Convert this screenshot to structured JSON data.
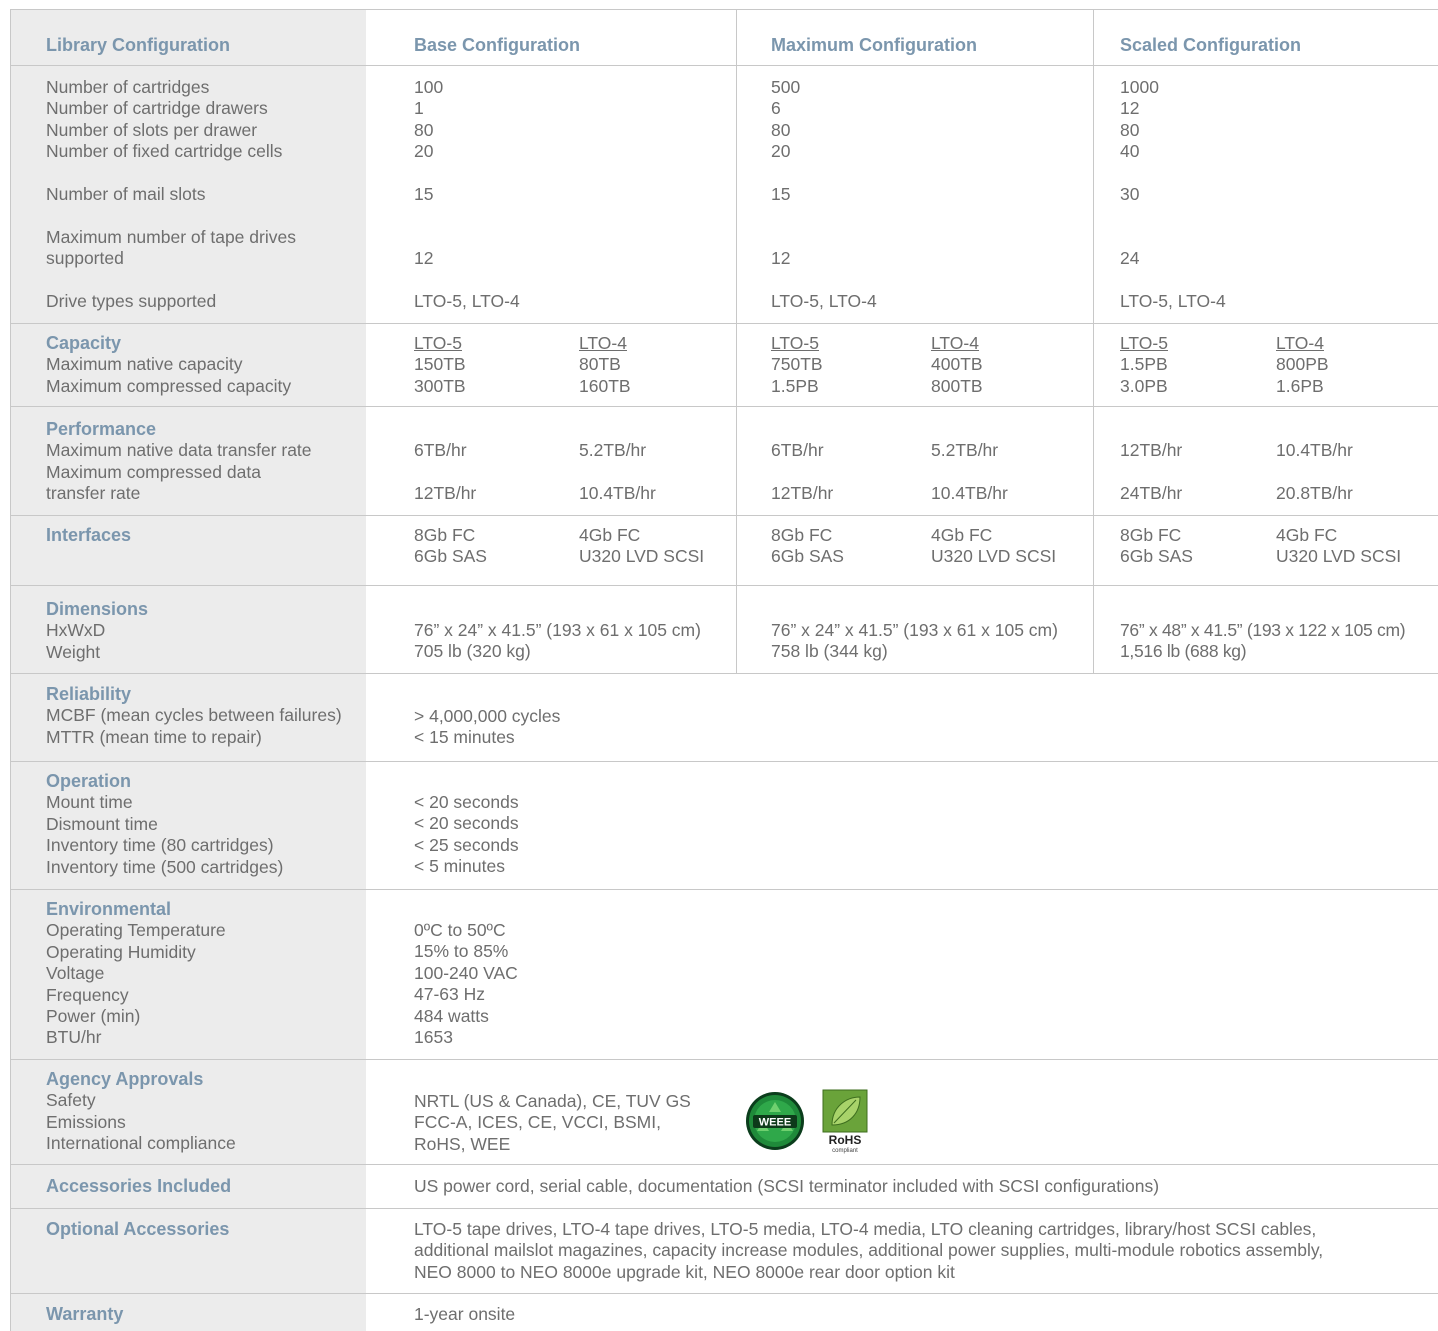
{
  "header": {
    "library_configuration": "Library Configuration",
    "base": "Base Configuration",
    "maximum": "Maximum Configuration",
    "scaled": "Scaled Configuration"
  },
  "config": {
    "labels": [
      "Number of cartridges",
      "Number of cartridge drawers",
      "Number of slots per drawer",
      "Number of fixed cartridge cells"
    ],
    "base": [
      "100",
      "1",
      "80",
      "20"
    ],
    "maximum": [
      "500",
      "6",
      "80",
      "20"
    ],
    "scaled": [
      "1000",
      "12",
      "80",
      "40"
    ],
    "mail_label": "Number of mail slots",
    "mail": {
      "base": "15",
      "maximum": "15",
      "scaled": "30"
    },
    "drives_label_1": "Maximum number of tape drives",
    "drives_label_2": "supported",
    "drives": {
      "base": "12",
      "maximum": "12",
      "scaled": "24"
    },
    "types_label": "Drive types supported",
    "types": {
      "base": "LTO-5, LTO-4",
      "maximum": "LTO-5, LTO-4",
      "scaled": "LTO-5, LTO-4"
    }
  },
  "capacity": {
    "title": "Capacity",
    "labels": [
      "Maximum native capacity",
      "Maximum compressed capacity"
    ],
    "lto5": "LTO-5",
    "lto4": "LTO-4",
    "base": {
      "lto5": [
        "150TB",
        "300TB"
      ],
      "lto4": [
        "80TB",
        "160TB"
      ]
    },
    "maximum": {
      "lto5": [
        "750TB",
        "1.5PB"
      ],
      "lto4": [
        "400TB",
        "800TB"
      ]
    },
    "scaled": {
      "lto5": [
        "1.5PB",
        "3.0PB"
      ],
      "lto4": [
        "800PB",
        "1.6PB"
      ]
    }
  },
  "performance": {
    "title": "Performance",
    "native_label": "Maximum native data transfer rate",
    "compressed_label_1": "Maximum compressed data",
    "compressed_label_2": "transfer rate",
    "base": {
      "lto5": [
        "6TB/hr",
        "12TB/hr"
      ],
      "lto4": [
        "5.2TB/hr",
        "10.4TB/hr"
      ]
    },
    "maximum": {
      "lto5": [
        "6TB/hr",
        "12TB/hr"
      ],
      "lto4": [
        "5.2TB/hr",
        "10.4TB/hr"
      ]
    },
    "scaled": {
      "lto5": [
        "12TB/hr",
        "24TB/hr"
      ],
      "lto4": [
        "10.4TB/hr",
        "20.8TB/hr"
      ]
    }
  },
  "interfaces": {
    "title": "Interfaces",
    "lto5": [
      "8Gb FC",
      "6Gb SAS"
    ],
    "lto4": [
      "4Gb FC",
      "U320 LVD SCSI"
    ]
  },
  "dimensions": {
    "title": "Dimensions",
    "labels": [
      "HxWxD",
      "Weight"
    ],
    "base": [
      "76” x 24” x 41.5” (193 x 61 x 105 cm)",
      "705 lb (320 kg)"
    ],
    "maximum": [
      "76” x 24” x 41.5” (193 x 61 x 105 cm)",
      "758 lb (344 kg)"
    ],
    "scaled": [
      "76” x 48” x 41.5” (193 x 122 x 105 cm)",
      "1,516 lb (688 kg)"
    ]
  },
  "reliability": {
    "title": "Reliability",
    "labels": [
      "MCBF (mean cycles between failures)",
      "MTTR (mean time to repair)"
    ],
    "values": [
      "> 4,000,000 cycles",
      "< 15 minutes"
    ]
  },
  "operation": {
    "title": "Operation",
    "labels": [
      "Mount time",
      "Dismount time",
      "Inventory time (80 cartridges)",
      "Inventory time (500 cartridges)"
    ],
    "values": [
      "< 20 seconds",
      "< 20 seconds",
      "< 25 seconds",
      "< 5 minutes"
    ]
  },
  "environmental": {
    "title": "Environmental",
    "labels": [
      "Operating Temperature",
      "Operating Humidity",
      "Voltage",
      "Frequency",
      "Power (min)",
      "BTU/hr"
    ],
    "values": [
      "0ºC to 50ºC",
      "15% to 85%",
      "100-240 VAC",
      "47-63 Hz",
      "484 watts",
      "1653"
    ]
  },
  "agency": {
    "title": "Agency Approvals",
    "labels": [
      "Safety",
      "Emissions",
      "International compliance"
    ],
    "values": [
      "NRTL (US & Canada), CE, TUV GS",
      "FCC-A, ICES, CE, VCCI, BSMI,",
      "RoHS, WEE"
    ],
    "weee_logo": "WEEE",
    "rohs_logo": "RoHS",
    "rohs_sub": "compliant"
  },
  "accessories": {
    "title": "Accessories Included",
    "value": "US power cord, serial cable, documentation (SCSI terminator included with SCSI configurations)"
  },
  "optional": {
    "title": "Optional Accessories",
    "lines": [
      "LTO-5 tape drives, LTO-4 tape drives, LTO-5 media, LTO-4 media, LTO cleaning cartridges, library/host SCSI cables,",
      "additional mailslot magazines, capacity increase modules, additional power supplies, multi-module robotics assembly,",
      "NEO 8000 to NEO 8000e upgrade kit, NEO 8000e rear door option kit"
    ]
  },
  "warranty": {
    "title": "Warranty",
    "value": "1-year onsite"
  },
  "colors": {
    "heading": "#7b96ad",
    "text": "#6e6e6e",
    "label_bg": "#ececec",
    "rule": "#c8c8c8"
  }
}
